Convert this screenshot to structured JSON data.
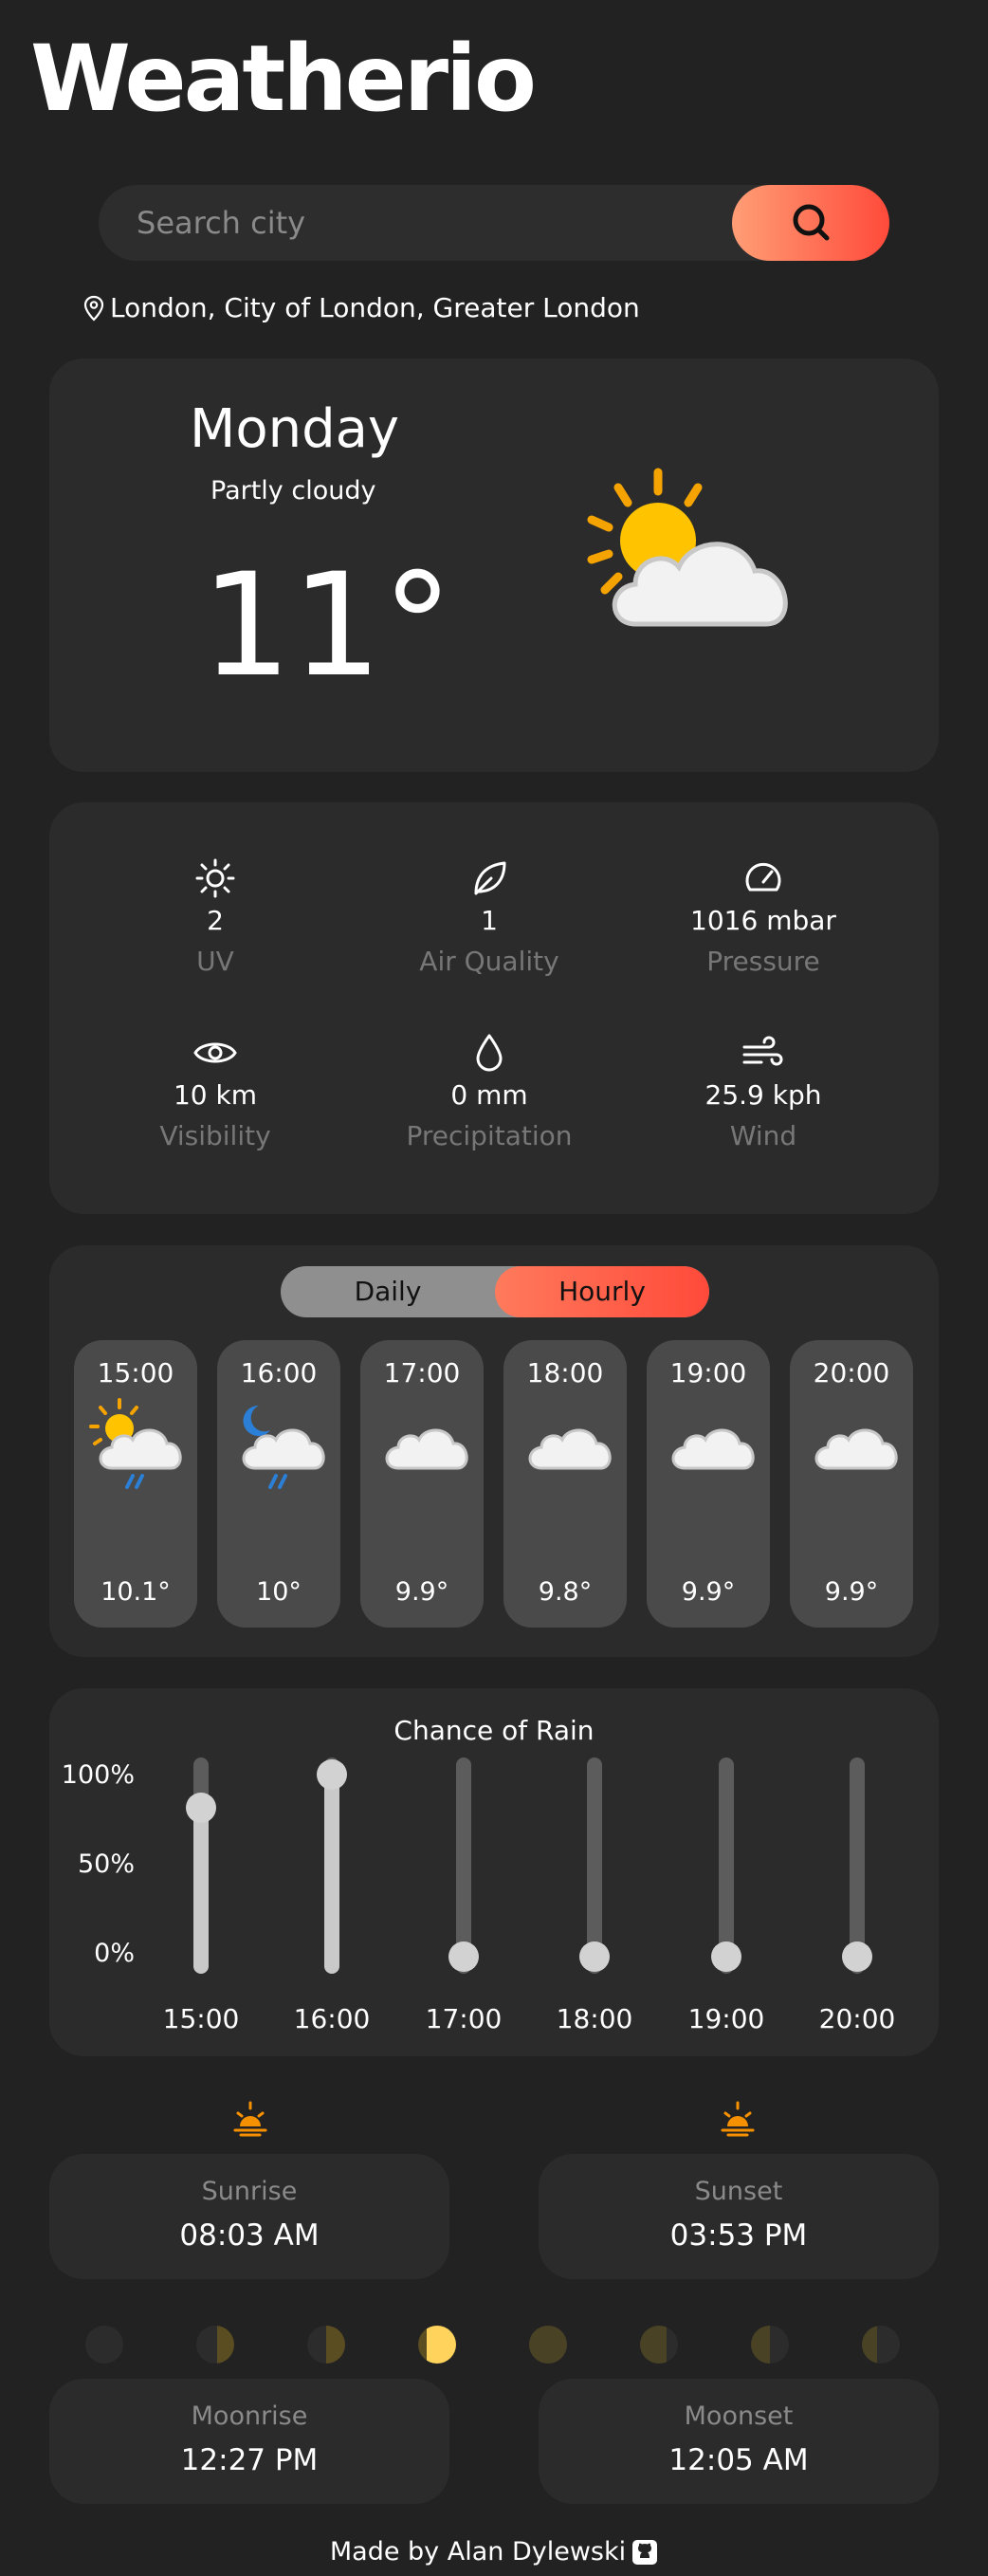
{
  "app": {
    "title": "Weatherio"
  },
  "search": {
    "placeholder": "Search city"
  },
  "location": {
    "text": "London, City of London, Greater London"
  },
  "current": {
    "day": "Monday",
    "condition": "Partly cloudy",
    "temperature": "11°"
  },
  "stats": {
    "uv": {
      "value": "2",
      "label": "UV"
    },
    "air_quality": {
      "value": "1",
      "label": "Air Quality"
    },
    "pressure": {
      "value": "1016 mbar",
      "label": "Pressure"
    },
    "visibility": {
      "value": "10 km",
      "label": "Visibility"
    },
    "precipitation": {
      "value": "0 mm",
      "label": "Precipitation"
    },
    "wind": {
      "value": "25.9 kph",
      "label": "Wind"
    }
  },
  "forecast": {
    "toggle": {
      "daily": "Daily",
      "hourly": "Hourly",
      "active": "hourly"
    },
    "hours": [
      {
        "time": "15:00",
        "temp": "10.1°",
        "icon": "sun-cloud-rain-icon"
      },
      {
        "time": "16:00",
        "temp": "10°",
        "icon": "moon-cloud-rain-icon"
      },
      {
        "time": "17:00",
        "temp": "9.9°",
        "icon": "cloud-icon"
      },
      {
        "time": "18:00",
        "temp": "9.8°",
        "icon": "cloud-icon"
      },
      {
        "time": "19:00",
        "temp": "9.9°",
        "icon": "cloud-icon"
      },
      {
        "time": "20:00",
        "temp": "9.9°",
        "icon": "cloud-icon"
      }
    ]
  },
  "rain": {
    "title": "Chance of Rain",
    "y_labels": [
      "100%",
      "50%",
      "0%"
    ],
    "hours": [
      "15:00",
      "16:00",
      "17:00",
      "18:00",
      "19:00",
      "20:00"
    ],
    "chance": [
      0.82,
      1.0,
      0,
      0,
      0,
      0
    ]
  },
  "sun": {
    "sunrise_label": "Sunrise",
    "sunrise": "08:03 AM",
    "sunset_label": "Sunset",
    "sunset": "03:53 PM"
  },
  "moon": {
    "moonrise_label": "Moonrise",
    "moonrise": "12:27 PM",
    "moonset_label": "Moonset",
    "moonset": "12:05 AM",
    "active_phase_index": 3
  },
  "footer": {
    "text": "Made by Alan Dylewski"
  },
  "colors": {
    "accent_start": "#ff9e76",
    "accent_end": "#ff4a3a",
    "background": "#222222",
    "card": "#2b2b2b"
  }
}
